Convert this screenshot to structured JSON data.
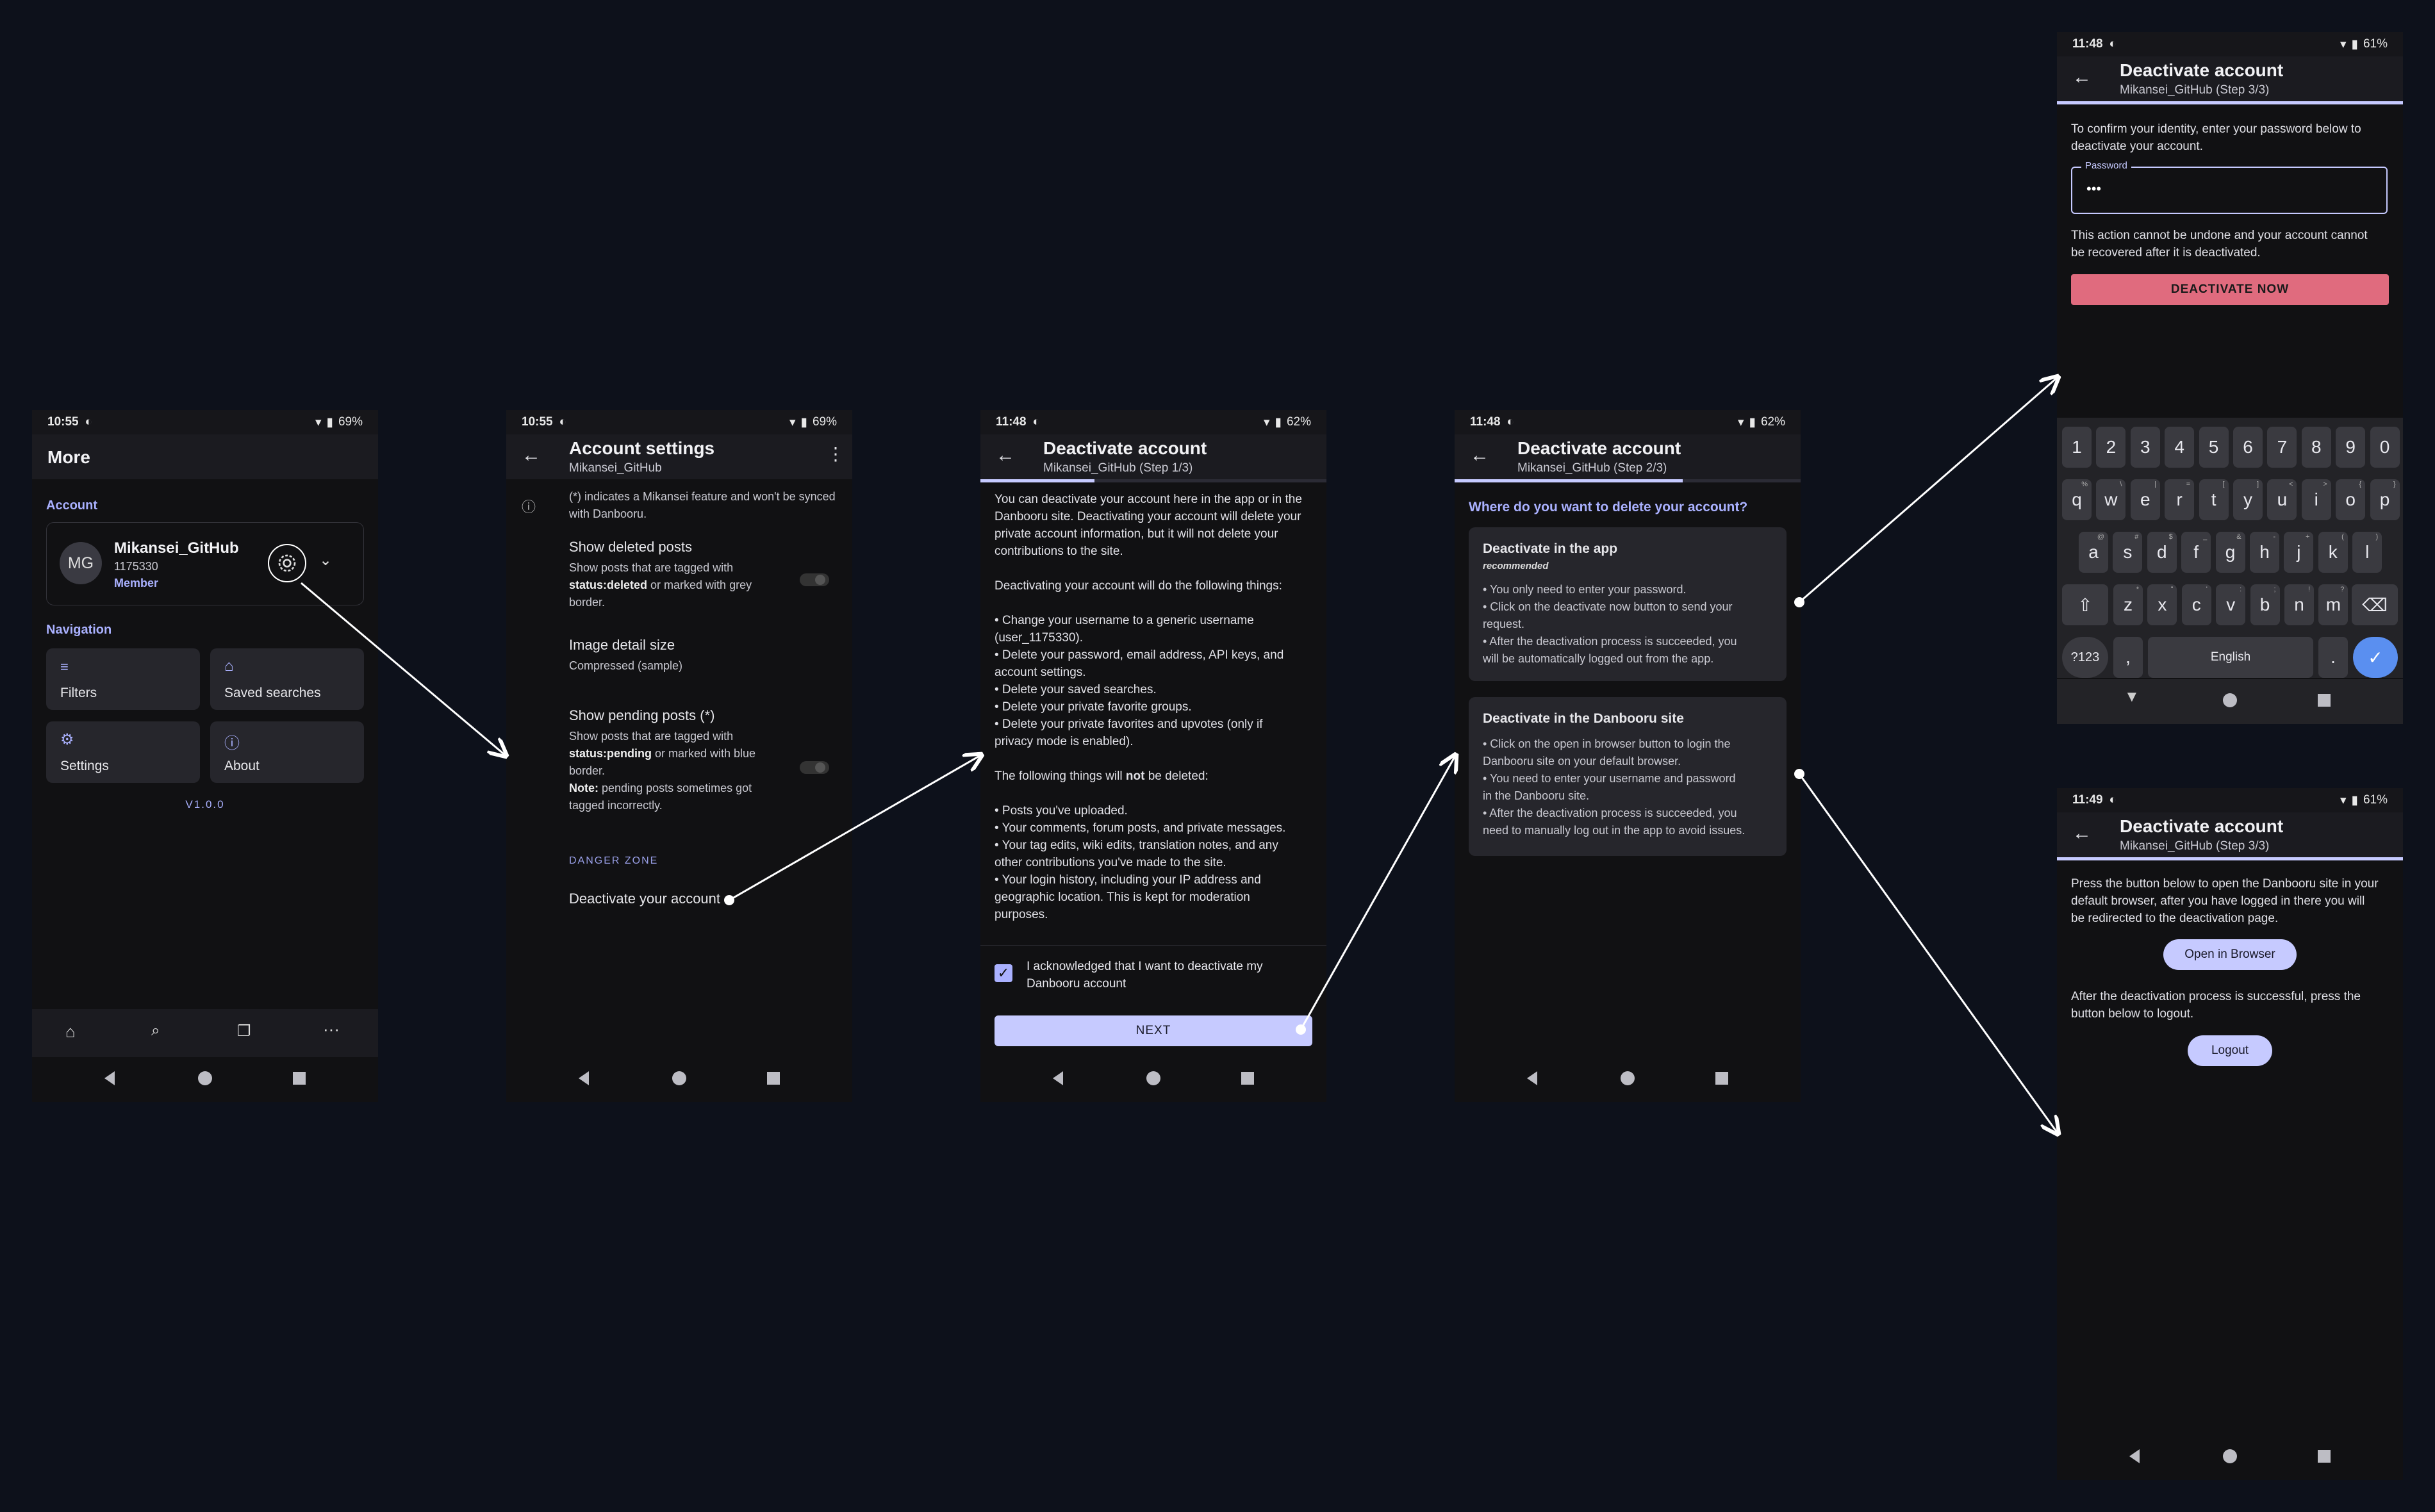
{
  "screen1": {
    "time": "10:55",
    "battery": "69%",
    "title": "More",
    "account_header": "Account",
    "avatar_initials": "MG",
    "username": "Mikansei_GitHub",
    "user_id": "1175330",
    "role": "Member",
    "navigation_header": "Navigation",
    "tiles": [
      "Filters",
      "Saved searches",
      "Settings",
      "About"
    ],
    "version": "V1.0.0"
  },
  "screen2": {
    "time": "10:55",
    "battery": "69%",
    "title": "Account settings",
    "subtitle": "Mikansei_GitHub",
    "info_note": "(*) indicates a Mikansei feature and won't be synced with Danbooru.",
    "deleted_title": "Show deleted posts",
    "deleted_desc_1": "Show posts that are tagged with",
    "deleted_desc_2_bold": "status:deleted",
    "deleted_desc_2_rest": " or marked with grey",
    "deleted_desc_3": "border.",
    "image_size_title": "Image detail size",
    "image_size_value": "Compressed (sample)",
    "pending_title": "Show pending posts (*)",
    "pending_desc_1": "Show posts that are tagged with",
    "pending_desc_2_bold": "status:pending",
    "pending_desc_2_rest": " or marked with blue",
    "pending_desc_3": "border.",
    "pending_note_bold": "Note:",
    "pending_note_rest": " pending posts sometimes got",
    "pending_note_2": "tagged incorrectly.",
    "danger_zone": "DANGER ZONE",
    "deactivate": "Deactivate your account"
  },
  "screen3": {
    "time": "11:48",
    "battery": "62%",
    "title": "Deactivate account",
    "subtitle": "Mikansei_GitHub (Step 1/3)",
    "step_progress": 0.33,
    "intro": [
      "You can deactivate your account here in the app or in the",
      "Danbooru site. Deactivating your account will delete your",
      "private account information, but it will not delete your",
      "contributions to the site."
    ],
    "will_do": "Deactivating your account will do the following things:",
    "do_items": [
      "Change your username to a generic username",
      "(user_1175330).",
      "Delete your password, email address, API keys, and",
      "account settings.",
      "Delete your saved searches.",
      "Delete your private favorite groups.",
      "Delete your private favorites and upvotes (only if",
      "privacy mode is enabled)."
    ],
    "not_deleted_pre": "The following things will ",
    "not_deleted_bold": "not",
    "not_deleted_post": " be deleted:",
    "keep_items": [
      "Posts you've uploaded.",
      "Your comments, forum posts, and private messages.",
      "Your tag edits, wiki edits, translation notes, and any",
      "other contributions you've made to the site.",
      "Your login history, including your IP address and",
      "geographic location. This is kept for moderation",
      "purposes."
    ],
    "ack_1": "I acknowledged that I want to deactivate my",
    "ack_2": "Danbooru account",
    "ack_checked": true,
    "next": "NEXT"
  },
  "screen4": {
    "time": "11:48",
    "battery": "62%",
    "title": "Deactivate account",
    "subtitle": "Mikansei_GitHub (Step 2/3)",
    "step_progress": 0.66,
    "question": "Where do you want to delete your account?",
    "app_title": "Deactivate in the app",
    "app_badge": "recommended",
    "app_items": [
      "You only need to enter your password.",
      "Click on the deactivate now button to send your",
      "request.",
      "After the deactivation process is succeeded, you",
      "will be automatically logged out from the app."
    ],
    "site_title": "Deactivate in the Danbooru site",
    "site_items": [
      "Click on the open in browser button to login the",
      "Danbooru site on your default browser.",
      "You need to enter your username and password",
      "in the Danbooru site.",
      "After the deactivation process is succeeded, you",
      "need to manually log out in the app to avoid issues."
    ]
  },
  "screen5": {
    "time": "11:48",
    "battery": "61%",
    "title": "Deactivate account",
    "subtitle": "Mikansei_GitHub (Step 3/3)",
    "step_progress": 1.0,
    "instruction_1": "To confirm your identity, enter your password below to",
    "instruction_2": "deactivate your account.",
    "password_label": "Password",
    "password_value": "•••",
    "warning_1": "This action cannot be undone and your account cannot",
    "warning_2": "be recovered after it is deactivated.",
    "button": "DEACTIVATE NOW",
    "keyboard": {
      "row_numbers": [
        "1",
        "2",
        "3",
        "4",
        "5",
        "6",
        "7",
        "8",
        "9",
        "0"
      ],
      "row1": [
        "q",
        "w",
        "e",
        "r",
        "t",
        "y",
        "u",
        "i",
        "o",
        "p"
      ],
      "row1_hints": [
        "%",
        "\\",
        "|",
        "=",
        "[",
        "]",
        "<",
        ">",
        "{",
        "}"
      ],
      "row2": [
        "a",
        "s",
        "d",
        "f",
        "g",
        "h",
        "j",
        "k",
        "l"
      ],
      "row2_hints": [
        "@",
        "#",
        "$",
        "_",
        "&",
        "-",
        "+",
        "(",
        ")"
      ],
      "row3": [
        "z",
        "x",
        "c",
        "v",
        "b",
        "n",
        "m"
      ],
      "row3_hints": [
        "*",
        "\"",
        "'",
        ":",
        ";",
        "!",
        "?"
      ],
      "symbols": "?123",
      "comma": ",",
      "space": "English",
      "period": "."
    }
  },
  "screen6": {
    "time": "11:49",
    "battery": "61%",
    "title": "Deactivate account",
    "subtitle": "Mikansei_GitHub (Step 3/3)",
    "step_progress": 1.0,
    "text1": [
      "Press the button below to open the Danbooru site in your",
      "default browser, after you have logged in there you will",
      "be redirected to the deactivation page."
    ],
    "open_browser": "Open in Browser",
    "text2": [
      "After the deactivation process is successful, press the",
      "button below to logout."
    ],
    "logout": "Logout"
  },
  "colors": {
    "background": "#0d111b",
    "accent": "#aab1ff",
    "button": "#c6caff",
    "danger": "#e06b7e"
  }
}
